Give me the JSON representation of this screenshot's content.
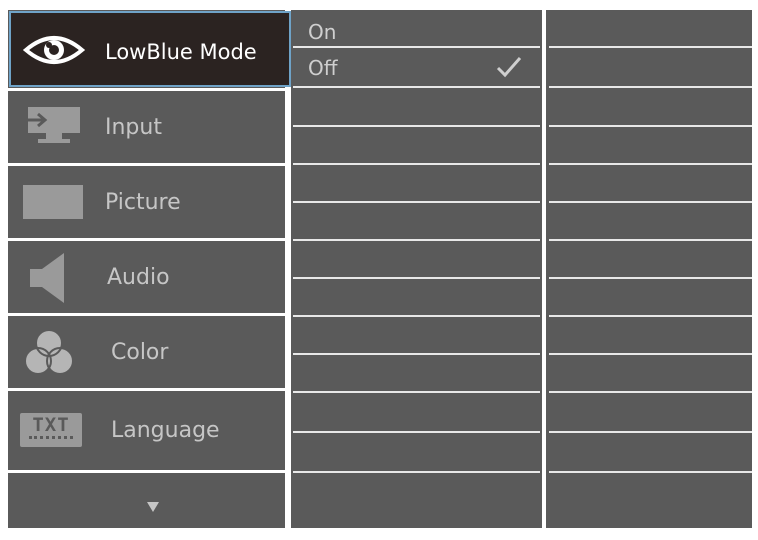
{
  "menu": {
    "items": [
      {
        "label": "LowBlue Mode",
        "icon": "eye-icon",
        "selected": true
      },
      {
        "label": "Input",
        "icon": "input-icon"
      },
      {
        "label": "Picture",
        "icon": "picture-icon"
      },
      {
        "label": "Audio",
        "icon": "speaker-icon"
      },
      {
        "label": "Color",
        "icon": "color-circles-icon"
      },
      {
        "label": "Language",
        "icon": "txt-icon",
        "icon_text": "TXT"
      }
    ],
    "more_icon": "down-arrow-icon"
  },
  "submenu": {
    "options": [
      {
        "label": "On",
        "checked": false
      },
      {
        "label": "Off",
        "checked": true
      }
    ]
  },
  "colors": {
    "panel": "#5a5a5a",
    "selected_bg": "#2b2321",
    "selected_border": "#6fa3c8",
    "text": "#c6c6c6",
    "lines": "#e8e8e8"
  }
}
